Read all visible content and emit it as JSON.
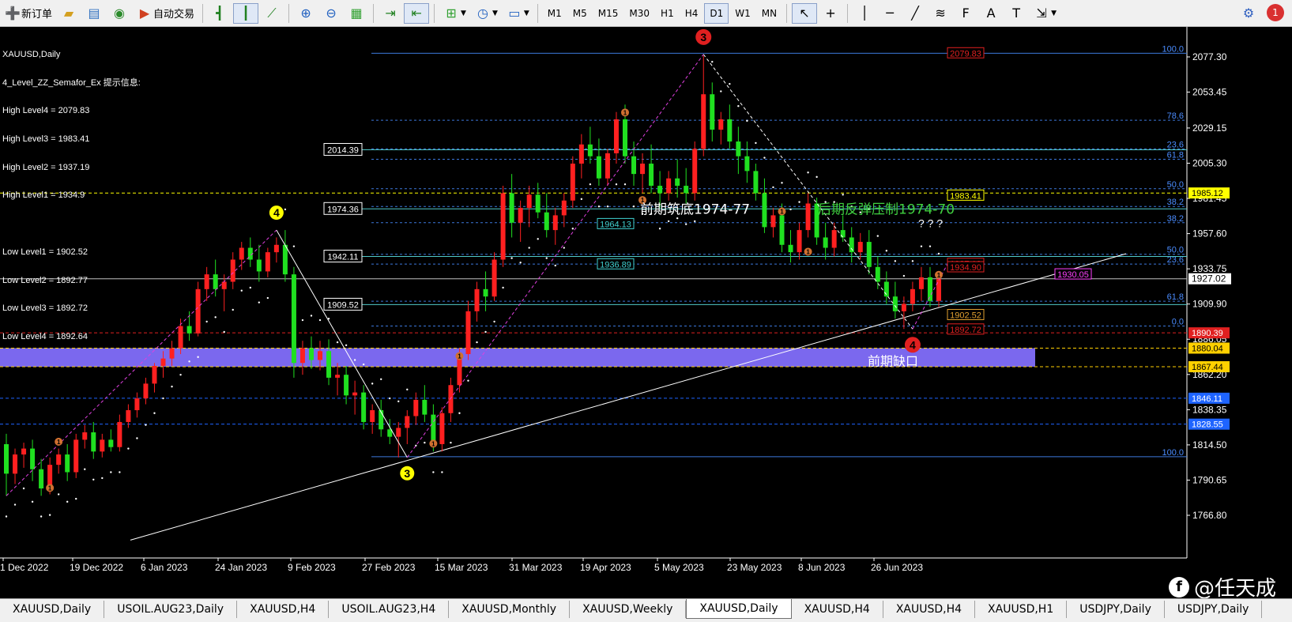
{
  "toolbar": {
    "new_order": "新订单",
    "auto_trade": "自动交易",
    "timeframes": [
      "M1",
      "M5",
      "M15",
      "M30",
      "H1",
      "H4",
      "D1",
      "W1",
      "MN"
    ],
    "active_timeframe": "D1",
    "notify_count": "1",
    "icons": [
      "gold-bars-icon",
      "navigator-icon",
      "signal-icon",
      "autotrade-icon",
      "bar-chart-icon",
      "candles-icon",
      "line-chart-icon",
      "zoom-in-icon",
      "zoom-out-icon",
      "tile-icon",
      "scroll-icon",
      "autoscroll-icon",
      "indicators-icon",
      "periods-icon",
      "templates-icon",
      "cursor-icon",
      "crosshair-icon",
      "vline-icon",
      "hline-icon",
      "trendline-icon",
      "fibo-icon",
      "text-icon",
      "label-icon",
      "arrows-icon"
    ]
  },
  "info": {
    "title": "XAUUSD,Daily",
    "indicator": "4_Level_ZZ_Semafor_Ex 提示信息:",
    "high_levels": [
      "High Level4 = 2079.83",
      "High Level3 = 1983.41",
      "High Level2 = 1937.19",
      "High Level1 = 1934.9"
    ],
    "low_levels": [
      "Low Level1 = 1902.52",
      "Low Level2 = 1892.77",
      "Low Level3 = 1892.72",
      "Low Level4 = 1892.64"
    ]
  },
  "chart_data": {
    "type": "candlestick",
    "symbol": "XAUUSD",
    "timeframe": "Daily",
    "ylim": [
      1750,
      2095
    ],
    "y_ticks": [
      2077.3,
      2053.45,
      2029.15,
      2005.3,
      1981.45,
      1957.6,
      1933.75,
      1909.9,
      1886.05,
      1862.2,
      1838.35,
      1814.5,
      1790.65,
      1766.8
    ],
    "x_ticks": [
      "1 Dec 2022",
      "19 Dec 2022",
      "6 Jan 2023",
      "24 Jan 2023",
      "9 Feb 2023",
      "27 Feb 2023",
      "15 Mar 2023",
      "31 Mar 2023",
      "19 Apr 2023",
      "5 May 2023",
      "23 May 2023",
      "8 Jun 2023",
      "26 Jun 2023"
    ],
    "current_price": "1927.02",
    "price_badges": [
      {
        "label": "1985.12",
        "value": 1985.12,
        "color": "#ffff00",
        "text": "#000"
      },
      {
        "label": "1890.39",
        "value": 1890.39,
        "color": "#e02020",
        "text": "#fff"
      },
      {
        "label": "1880.04",
        "value": 1880.04,
        "color": "#ffd000",
        "text": "#000"
      },
      {
        "label": "1867.44",
        "value": 1867.44,
        "color": "#ffd000",
        "text": "#000"
      },
      {
        "label": "1846.11",
        "value": 1846.11,
        "color": "#1e64ff",
        "text": "#fff"
      },
      {
        "label": "1828.55",
        "value": 1828.55,
        "color": "#1e64ff",
        "text": "#fff"
      }
    ],
    "hlines": [
      {
        "label": "2014.39",
        "value": 2014.39
      },
      {
        "label": "1974.36",
        "value": 1974.36
      },
      {
        "label": "1942.11",
        "value": 1942.11
      },
      {
        "label": "1909.52",
        "value": 1909.52
      }
    ],
    "fib_levels": [
      {
        "label": "100.0",
        "value": 2079.8
      },
      {
        "label": "78.6",
        "value": 2034.4
      },
      {
        "label": "23.6",
        "value": 2015.0
      },
      {
        "label": "61.8",
        "value": 2008.0
      },
      {
        "label": "50.0",
        "value": 1988.0
      },
      {
        "label": "38.2",
        "value": 1976.0
      },
      {
        "label": "38.2",
        "value": 1965.0
      },
      {
        "label": "50.0",
        "value": 1943.6
      },
      {
        "label": "23.6",
        "value": 1937.0
      },
      {
        "label": "61.8",
        "value": 1911.8
      },
      {
        "label": "0.0",
        "value": 1895.0
      },
      {
        "label": "100.0",
        "value": 1806.5
      }
    ],
    "level_labels": [
      {
        "label": "2079.83",
        "value": 2079.83,
        "color": "#e02020"
      },
      {
        "label": "1983.41",
        "value": 1983.41,
        "color": "#ffff00"
      },
      {
        "label": "1937.19",
        "value": 1937.19,
        "color": "#e02020"
      },
      {
        "label": "1934.90",
        "value": 1934.9,
        "color": "#e02020"
      },
      {
        "label": "1902.52",
        "value": 1902.52,
        "color": "#e0a030"
      },
      {
        "label": "1892.72",
        "value": 1892.72,
        "color": "#e02020"
      },
      {
        "label": "1930.05",
        "value": 1930.05,
        "color": "#ff40ff"
      },
      {
        "label": "1964.13",
        "value": 1964.13,
        "color": "#40d0d0"
      },
      {
        "label": "1936.89",
        "value": 1936.89,
        "color": "#40d0d0"
      }
    ],
    "gap_zone": [
      1880.04,
      1867.44
    ],
    "annotations": {
      "prev_bottom": "前期筑底1974-77",
      "resistance": "后期反弹压制1974-70",
      "gap": "前期缺口",
      "questions": "? ? ?"
    },
    "semafor_marks": [
      "4",
      "3",
      "3",
      "4",
      "1"
    ],
    "candles": [
      [
        1815,
        1822,
        1780,
        1795
      ],
      [
        1795,
        1812,
        1788,
        1808
      ],
      [
        1808,
        1816,
        1799,
        1812
      ],
      [
        1812,
        1818,
        1790,
        1798
      ],
      [
        1798,
        1805,
        1780,
        1785
      ],
      [
        1785,
        1806,
        1781,
        1801
      ],
      [
        1801,
        1812,
        1795,
        1808
      ],
      [
        1808,
        1815,
        1790,
        1796
      ],
      [
        1796,
        1822,
        1792,
        1818
      ],
      [
        1818,
        1828,
        1812,
        1823
      ],
      [
        1823,
        1830,
        1805,
        1810
      ],
      [
        1810,
        1822,
        1806,
        1818
      ],
      [
        1818,
        1825,
        1810,
        1813
      ],
      [
        1813,
        1835,
        1810,
        1830
      ],
      [
        1830,
        1842,
        1826,
        1838
      ],
      [
        1838,
        1850,
        1833,
        1846
      ],
      [
        1846,
        1860,
        1842,
        1856
      ],
      [
        1856,
        1870,
        1850,
        1868
      ],
      [
        1868,
        1878,
        1860,
        1873
      ],
      [
        1873,
        1885,
        1868,
        1880
      ],
      [
        1880,
        1900,
        1876,
        1895
      ],
      [
        1895,
        1905,
        1885,
        1890
      ],
      [
        1890,
        1925,
        1888,
        1920
      ],
      [
        1920,
        1935,
        1912,
        1930
      ],
      [
        1930,
        1940,
        1915,
        1920
      ],
      [
        1920,
        1930,
        1905,
        1925
      ],
      [
        1925,
        1945,
        1920,
        1940
      ],
      [
        1940,
        1952,
        1933,
        1948
      ],
      [
        1948,
        1955,
        1935,
        1940
      ],
      [
        1940,
        1950,
        1925,
        1932
      ],
      [
        1932,
        1948,
        1928,
        1945
      ],
      [
        1945,
        1955,
        1938,
        1950
      ],
      [
        1950,
        1960,
        1925,
        1930
      ],
      [
        1930,
        1935,
        1860,
        1870
      ],
      [
        1870,
        1885,
        1862,
        1880
      ],
      [
        1880,
        1888,
        1866,
        1872
      ],
      [
        1872,
        1885,
        1865,
        1878
      ],
      [
        1878,
        1886,
        1855,
        1860
      ],
      [
        1860,
        1870,
        1848,
        1862
      ],
      [
        1862,
        1868,
        1842,
        1848
      ],
      [
        1848,
        1858,
        1835,
        1850
      ],
      [
        1850,
        1855,
        1825,
        1830
      ],
      [
        1830,
        1842,
        1822,
        1838
      ],
      [
        1838,
        1845,
        1820,
        1825
      ],
      [
        1825,
        1832,
        1815,
        1820
      ],
      [
        1820,
        1830,
        1806,
        1826
      ],
      [
        1826,
        1838,
        1815,
        1834
      ],
      [
        1834,
        1850,
        1828,
        1845
      ],
      [
        1845,
        1855,
        1830,
        1835
      ],
      [
        1835,
        1842,
        1810,
        1815
      ],
      [
        1815,
        1840,
        1810,
        1836
      ],
      [
        1836,
        1860,
        1830,
        1855
      ],
      [
        1855,
        1880,
        1850,
        1876
      ],
      [
        1876,
        1912,
        1872,
        1905
      ],
      [
        1905,
        1925,
        1898,
        1920
      ],
      [
        1920,
        1932,
        1905,
        1915
      ],
      [
        1915,
        1945,
        1912,
        1940
      ],
      [
        1940,
        1990,
        1935,
        1985
      ],
      [
        1985,
        1998,
        1955,
        1965
      ],
      [
        1965,
        1980,
        1952,
        1975
      ],
      [
        1975,
        1990,
        1962,
        1984
      ],
      [
        1984,
        1992,
        1968,
        1972
      ],
      [
        1972,
        1985,
        1955,
        1960
      ],
      [
        1960,
        1975,
        1950,
        1970
      ],
      [
        1970,
        1985,
        1962,
        1980
      ],
      [
        1980,
        2010,
        1975,
        2005
      ],
      [
        2005,
        2025,
        1995,
        2018
      ],
      [
        2018,
        2030,
        2005,
        2010
      ],
      [
        2010,
        2022,
        1990,
        1995
      ],
      [
        1995,
        2015,
        1990,
        2012
      ],
      [
        2012,
        2040,
        2005,
        2035
      ],
      [
        2035,
        2045,
        2005,
        2010
      ],
      [
        2010,
        2020,
        1990,
        1998
      ],
      [
        1998,
        2012,
        1985,
        2005
      ],
      [
        2005,
        2018,
        1985,
        1990
      ],
      [
        1990,
        2000,
        1975,
        1985
      ],
      [
        1985,
        2000,
        1980,
        1995
      ],
      [
        1995,
        2008,
        1982,
        1990
      ],
      [
        1990,
        2002,
        1978,
        1985
      ],
      [
        1985,
        2020,
        1980,
        2015
      ],
      [
        2015,
        2078,
        2010,
        2052
      ],
      [
        2052,
        2060,
        2020,
        2028
      ],
      [
        2028,
        2040,
        2018,
        2035
      ],
      [
        2035,
        2045,
        2015,
        2020
      ],
      [
        2020,
        2030,
        1998,
        2010
      ],
      [
        2010,
        2020,
        1992,
        2000
      ],
      [
        2000,
        2005,
        1980,
        1985
      ],
      [
        1985,
        1995,
        1958,
        1962
      ],
      [
        1962,
        1975,
        1955,
        1970
      ],
      [
        1970,
        1978,
        1945,
        1950
      ],
      [
        1950,
        1960,
        1938,
        1945
      ],
      [
        1945,
        1965,
        1940,
        1960
      ],
      [
        1960,
        1985,
        1955,
        1978
      ],
      [
        1978,
        1982,
        1950,
        1955
      ],
      [
        1955,
        1965,
        1940,
        1948
      ],
      [
        1948,
        1965,
        1942,
        1960
      ],
      [
        1960,
        1970,
        1952,
        1955
      ],
      [
        1955,
        1962,
        1938,
        1945
      ],
      [
        1945,
        1958,
        1940,
        1952
      ],
      [
        1952,
        1960,
        1930,
        1935
      ],
      [
        1935,
        1942,
        1920,
        1925
      ],
      [
        1925,
        1932,
        1910,
        1915
      ],
      [
        1915,
        1925,
        1900,
        1905
      ],
      [
        1905,
        1915,
        1893,
        1910
      ],
      [
        1910,
        1925,
        1905,
        1920
      ],
      [
        1920,
        1935,
        1912,
        1928
      ],
      [
        1928,
        1935,
        1908,
        1912
      ],
      [
        1912,
        1930,
        1908,
        1927
      ]
    ],
    "zigzag": [
      [
        0,
        1780
      ],
      [
        31,
        1960
      ],
      [
        46,
        1806
      ],
      [
        80,
        2079
      ],
      [
        104,
        1893
      ],
      [
        108,
        1937
      ]
    ],
    "trendline": {
      "from": [
        0,
        1745
      ],
      "to": [
        118,
        1944
      ]
    }
  },
  "tabs": [
    "XAUUSD,Daily",
    "USOIL.AUG23,Daily",
    "XAUUSD,H4",
    "USOIL.AUG23,H4",
    "XAUUSD,Monthly",
    "XAUUSD,Weekly",
    "XAUUSD,Daily",
    "XAUUSD,H4",
    "XAUUSD,H4",
    "XAUUSD,H1",
    "USDJPY,Daily",
    "USDJPY,Daily"
  ],
  "active_tab": 6,
  "watermark": {
    "text": "@任天成",
    "logo": "f"
  }
}
